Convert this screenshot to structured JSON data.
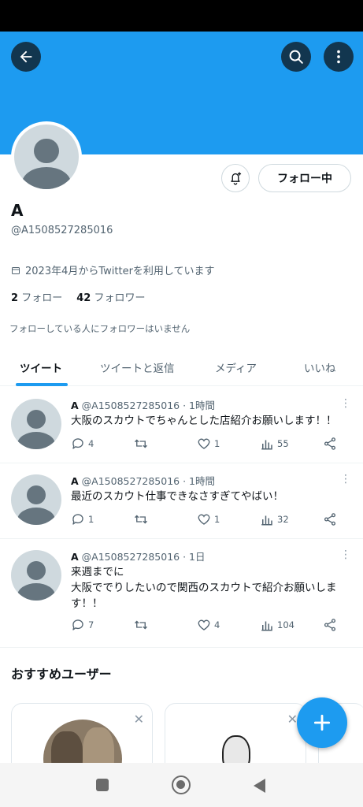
{
  "colors": {
    "accent": "#1d9bf0",
    "text": "#0f1419",
    "muted": "#536471",
    "border": "#cfd9de"
  },
  "header": {
    "back_icon": "back-arrow-icon",
    "search_icon": "search-icon",
    "more_icon": "more-vert-icon"
  },
  "profile": {
    "name": "A",
    "handle": "@A1508527285016",
    "joined": "2023年4月からTwitterを利用しています",
    "following_count": "2",
    "following_label": "フォロー",
    "followers_count": "42",
    "followers_label": "フォロワー",
    "mutual_note": "フォローしている人にフォロワーはいません",
    "follow_button": "フォロー中"
  },
  "tabs": [
    {
      "label": "ツイート",
      "active": true
    },
    {
      "label": "ツイートと返信",
      "active": false
    },
    {
      "label": "メディア",
      "active": false
    },
    {
      "label": "いいね",
      "active": false
    }
  ],
  "tweets": [
    {
      "name": "A",
      "handle_time": "@A1508527285016 · 1時間",
      "text": "大阪のスカウトでちゃんとした店紹介お願いします！！",
      "replies": "4",
      "likes": "1",
      "views": "55"
    },
    {
      "name": "A",
      "handle_time": "@A1508527285016 · 1時間",
      "text": "最近のスカウト仕事できなさすぎてやばい！",
      "replies": "1",
      "likes": "1",
      "views": "32"
    },
    {
      "name": "A",
      "handle_time": "@A1508527285016 · 1日",
      "text": "来週までに\n大阪ででりしたいので関西のスカウトで紹介お願いしま\nす！！",
      "replies": "7",
      "likes": "4",
      "views": "104"
    }
  ],
  "recommended": {
    "title": "おすすめユーザー"
  },
  "fab": {
    "icon": "plus-icon"
  }
}
